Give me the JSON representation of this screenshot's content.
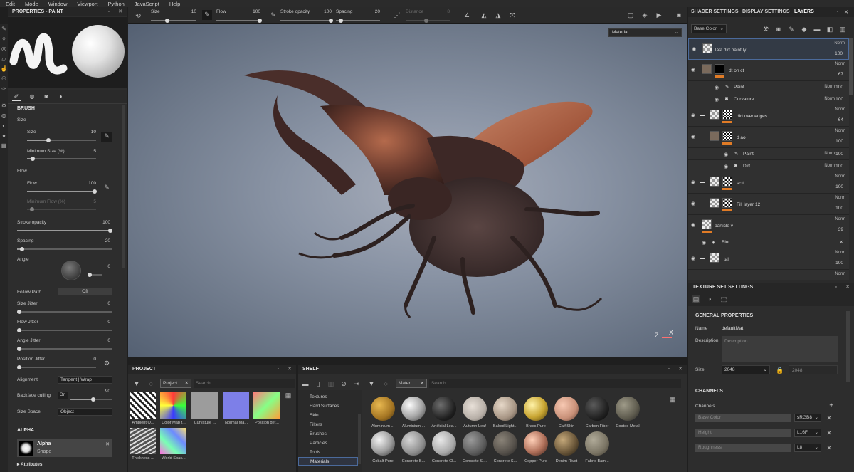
{
  "menu": [
    "Edit",
    "Mode",
    "Window",
    "Viewport",
    "Python",
    "JavaScript",
    "Help"
  ],
  "toolbar": {
    "size_label": "Size",
    "size_value": "10",
    "flow_label": "Flow",
    "flow_value": "100",
    "stroke_label": "Stroke opacity",
    "stroke_value": "100",
    "spacing_label": "Spacing",
    "spacing_value": "20",
    "distance_label": "Distance",
    "distance_value": "8"
  },
  "properties": {
    "title": "PROPERTIES - PAINT",
    "brush_section": "BRUSH",
    "size_group": "Size",
    "size_label": "Size",
    "size_value": "10",
    "min_size_label": "Minimum Size (%)",
    "min_size_value": "5",
    "flow_group": "Flow",
    "flow_label": "Flow",
    "flow_value": "100",
    "min_flow_label": "Minimum Flow (%)",
    "min_flow_value": "5",
    "stroke_label": "Stroke opacity",
    "stroke_value": "100",
    "spacing_label": "Spacing",
    "spacing_value": "20",
    "angle_label": "Angle",
    "angle_value": "0",
    "follow_path_label": "Follow Path",
    "follow_path_value": "Off",
    "size_jitter_label": "Size Jitter",
    "size_jitter_value": "0",
    "flow_jitter_label": "Flow Jitter",
    "flow_jitter_value": "0",
    "angle_jitter_label": "Angle Jitter",
    "angle_jitter_value": "0",
    "pos_jitter_label": "Position Jitter",
    "pos_jitter_value": "0",
    "alignment_label": "Alignment",
    "alignment_value": "Tangent | Wrap",
    "backface_label": "Backface culling",
    "backface_toggle": "On",
    "backface_value": "90",
    "size_space_label": "Size Space",
    "size_space_value": "Object",
    "alpha_section": "ALPHA",
    "alpha_name": "Alpha",
    "alpha_type": "Shape",
    "attributes": "Attributes"
  },
  "viewport": {
    "dropdown": "Material",
    "axis_z": "Z",
    "axis_x": "X"
  },
  "right": {
    "tabs": [
      "SHADER SETTINGS",
      "DISPLAY SETTINGS",
      "LAYERS"
    ],
    "channel_select": "Base Color",
    "layers": [
      {
        "name": "last dirt paint ly",
        "norm": "Norm",
        "op": "100"
      },
      {
        "name": "dt on ct",
        "norm": "Norm",
        "op": "67"
      },
      {
        "name": "Paint",
        "norm": "Norm",
        "op": "100"
      },
      {
        "name": "Curvature",
        "norm": "Norm",
        "op": "100"
      },
      {
        "name": "dirt over edges",
        "norm": "Norm",
        "op": "64"
      },
      {
        "name": "d ao",
        "norm": "Norm",
        "op": "100"
      },
      {
        "name": "Paint",
        "norm": "Norm",
        "op": "100"
      },
      {
        "name": "Dirt",
        "norm": "Norm",
        "op": "100"
      },
      {
        "name": "sctt",
        "norm": "Norm",
        "op": "100"
      },
      {
        "name": "Fill layer 12",
        "norm": "Norm",
        "op": "100"
      },
      {
        "name": "particle v",
        "norm": "Norm",
        "op": "39"
      },
      {
        "name": "Blur"
      },
      {
        "name": "tail",
        "norm": "Norm",
        "op": "100"
      },
      {
        "norm": "Norm"
      }
    ],
    "tss_title": "TEXTURE SET SETTINGS",
    "general": "GENERAL PROPERTIES",
    "name_label": "Name",
    "name_value": "defaultMat",
    "desc_label": "Description",
    "desc_placeholder": "Description",
    "size_label": "Size",
    "size_value": "2048",
    "size_value2": "2048",
    "channels_section": "CHANNELS",
    "channels_label": "Channels",
    "channels": [
      {
        "name": "Base Color",
        "format": "sRGB8"
      },
      {
        "name": "Height",
        "format": "L16F"
      },
      {
        "name": "Roughness",
        "format": "L8"
      }
    ]
  },
  "project": {
    "title": "PROJECT",
    "tag": "Project",
    "search_placeholder": "Search...",
    "items": [
      "Ambient O...",
      "Color Map f...",
      "Curvature ...",
      "Normal Ma...",
      "Position def...",
      "Thickness ...",
      "World Spac..."
    ]
  },
  "shelf": {
    "title": "SHELF",
    "tag": "Materi...",
    "search_placeholder": "Search...",
    "categories": [
      "Textures",
      "Hard Surfaces",
      "Skin",
      "Filters",
      "Brushes",
      "Particles",
      "Tools",
      "Materials"
    ],
    "materials": [
      "Aluminium ...",
      "Aluminium ...",
      "Artificial Lea...",
      "Autumn Leaf",
      "Baked Light...",
      "Brass Pure",
      "Calf Skin",
      "Carbon Fiber",
      "Coated Metal",
      "Cobalt Pure",
      "Concrete B...",
      "Concrete Cl...",
      "Concrete Si...",
      "Concrete S...",
      "Copper Pure",
      "Denim Rivet",
      "Fabric Bam..."
    ]
  }
}
